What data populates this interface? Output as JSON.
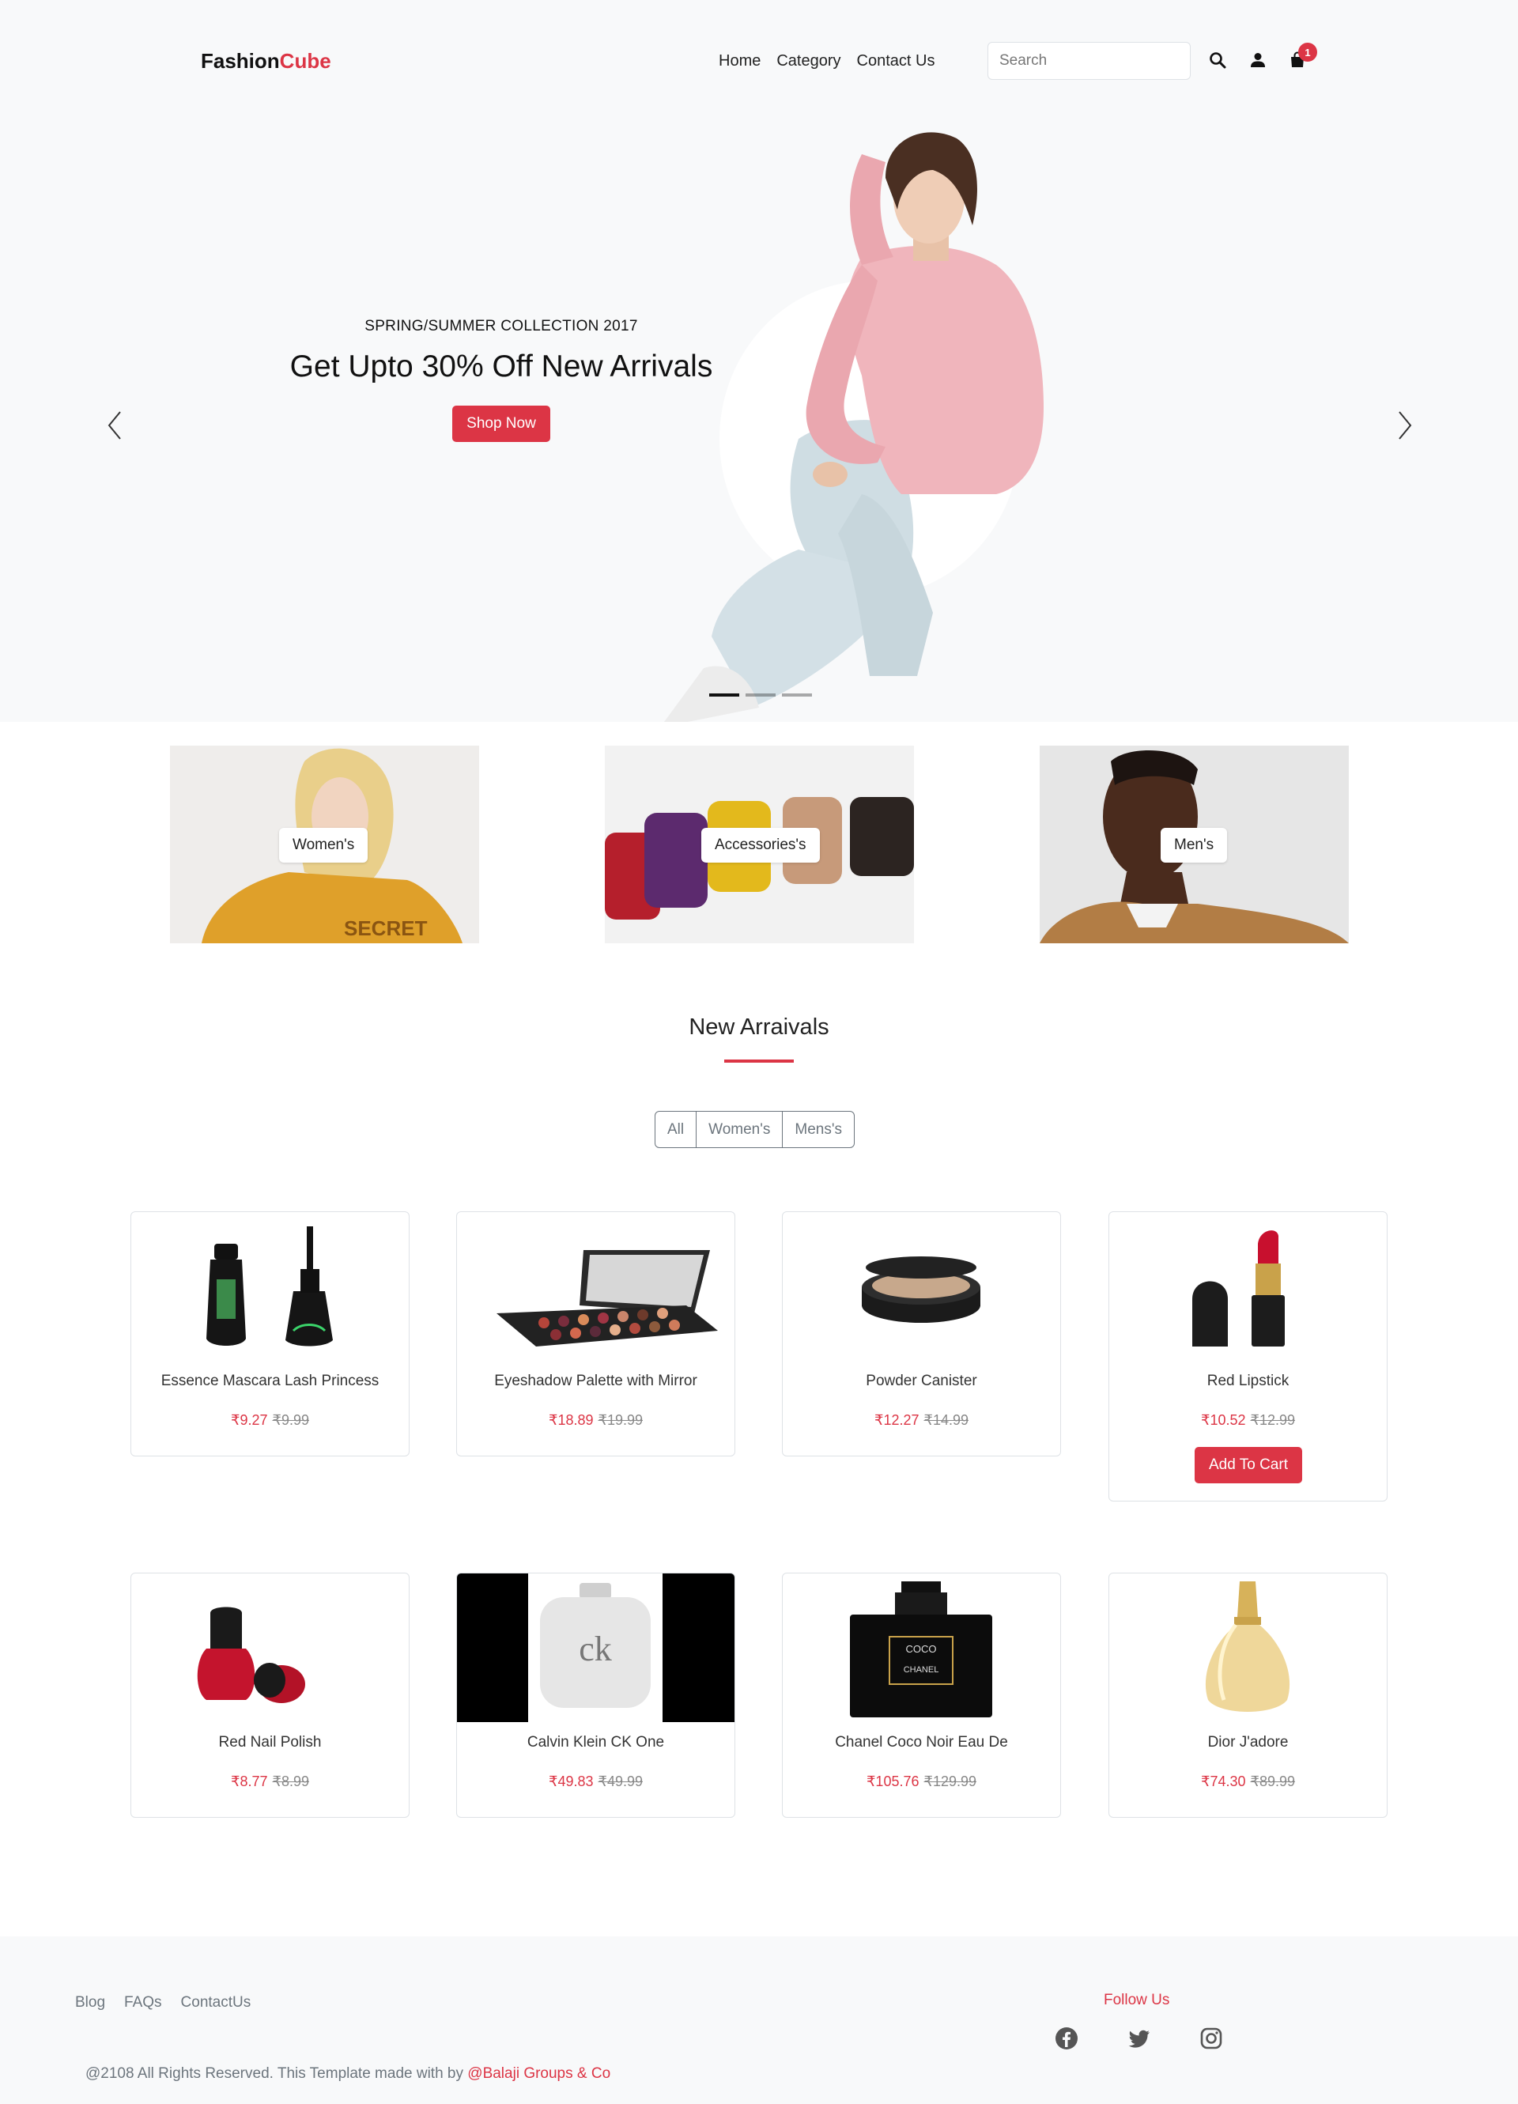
{
  "brand": {
    "part1": "Fashion",
    "part2": "Cube"
  },
  "nav": {
    "home": "Home",
    "category": "Category",
    "contact": "Contact Us"
  },
  "search": {
    "placeholder": "Search"
  },
  "cart": {
    "count": "1"
  },
  "hero": {
    "subtitle": "SPRING/SUMMER COLLECTION 2017",
    "title": "Get Upto 30% Off New Arrivals",
    "button": "Shop Now",
    "slides": 3,
    "active_slide": 1
  },
  "categories": [
    {
      "label": "Women's"
    },
    {
      "label": "Accessories's"
    },
    {
      "label": "Men's"
    }
  ],
  "arrivals": {
    "title": "New Arraivals",
    "filters": [
      "All",
      "Women's",
      "Mens's"
    ]
  },
  "products": [
    {
      "name": "Essence Mascara Lash Princess",
      "price": "₹9.27",
      "old_price": "₹9.99"
    },
    {
      "name": "Eyeshadow Palette with Mirror",
      "price": "₹18.89",
      "old_price": "₹19.99"
    },
    {
      "name": "Powder Canister",
      "price": "₹12.27",
      "old_price": "₹14.99"
    },
    {
      "name": "Red Lipstick",
      "price": "₹10.52",
      "old_price": "₹12.99",
      "button": "Add To Cart"
    },
    {
      "name": "Red Nail Polish",
      "price": "₹8.77",
      "old_price": "₹8.99"
    },
    {
      "name": "Calvin Klein CK One",
      "price": "₹49.83",
      "old_price": "₹49.99"
    },
    {
      "name": "Chanel Coco Noir Eau De",
      "price": "₹105.76",
      "old_price": "₹129.99"
    },
    {
      "name": "Dior J'adore",
      "price": "₹74.30",
      "old_price": "₹89.99"
    }
  ],
  "product_art": {
    "ck_text": "ck",
    "chanel_line1": "COCO",
    "chanel_line2": "CHANEL"
  },
  "footer": {
    "links": [
      "Blog",
      "FAQs",
      "ContactUs"
    ],
    "follow": "Follow Us",
    "social": [
      "facebook-icon",
      "twitter-icon",
      "instagram-icon"
    ],
    "copyright": "@2108 All Rights Reserved. This Template made with by ",
    "credit": "@Balaji Groups & Co"
  },
  "colors": {
    "accent": "#dc3545",
    "background": "#f8f9fa"
  }
}
